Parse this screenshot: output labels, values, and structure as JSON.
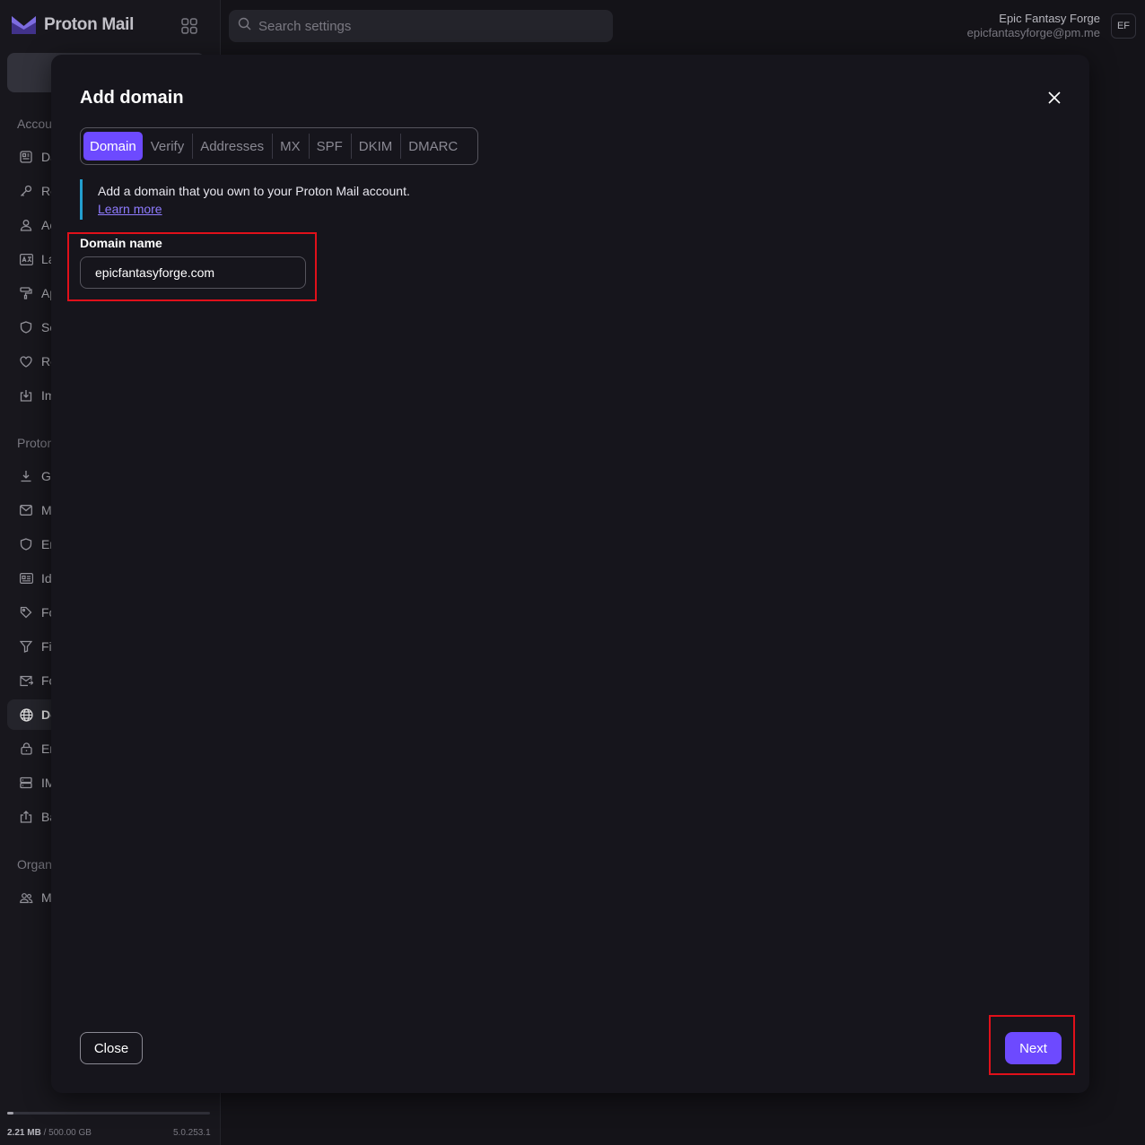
{
  "app": {
    "logo_text": "Proton Mail"
  },
  "search": {
    "placeholder": "Search settings"
  },
  "user": {
    "name": "Epic Fantasy Forge",
    "email": "epicfantasyforge@pm.me",
    "initials": "EF"
  },
  "sidebar": {
    "section_account": "Accou",
    "section_proton": "Proton",
    "section_org": "Organ",
    "items": [
      {
        "label": "Da",
        "icon": "dashboard-icon"
      },
      {
        "label": "Re",
        "icon": "key-icon"
      },
      {
        "label": "Ac",
        "icon": "user-icon"
      },
      {
        "label": "La",
        "icon": "language-icon"
      },
      {
        "label": "Ap",
        "icon": "paint-roller-icon"
      },
      {
        "label": "Se",
        "icon": "shield-icon"
      },
      {
        "label": "Re",
        "icon": "heart-icon"
      },
      {
        "label": "Im",
        "icon": "import-icon"
      },
      {
        "label": "Ge",
        "icon": "download-icon"
      },
      {
        "label": "M",
        "icon": "envelope-icon"
      },
      {
        "label": "En",
        "icon": "shield-icon"
      },
      {
        "label": "Id",
        "icon": "id-card-icon"
      },
      {
        "label": "Fo",
        "icon": "tag-icon"
      },
      {
        "label": "Fi",
        "icon": "filter-icon"
      },
      {
        "label": "Fo",
        "icon": "forward-icon"
      },
      {
        "label": "Do",
        "icon": "globe-icon"
      },
      {
        "label": "En",
        "icon": "lock-icon"
      },
      {
        "label": "IM",
        "icon": "server-icon"
      },
      {
        "label": "Ba",
        "icon": "upload-icon"
      },
      {
        "label": "M",
        "icon": "users-icon"
      }
    ],
    "storage_used": "2.21 MB",
    "storage_total": " / 500.00 GB",
    "storage_fraction": 0.004,
    "version": "5.0.253.1"
  },
  "modal": {
    "title": "Add domain",
    "steps": [
      "Domain",
      "Verify",
      "Addresses",
      "MX",
      "SPF",
      "DKIM",
      "DMARC"
    ],
    "active_step": "Domain",
    "info_text": "Add a domain that you own to your Proton Mail account.",
    "info_link": "Learn more",
    "field_label": "Domain name",
    "field_value": "epicfantasyforge.com",
    "close_label": "Close",
    "next_label": "Next"
  },
  "colors": {
    "accent": "#6d4aff",
    "info_border": "#239ece",
    "highlight": "#e0101a"
  }
}
